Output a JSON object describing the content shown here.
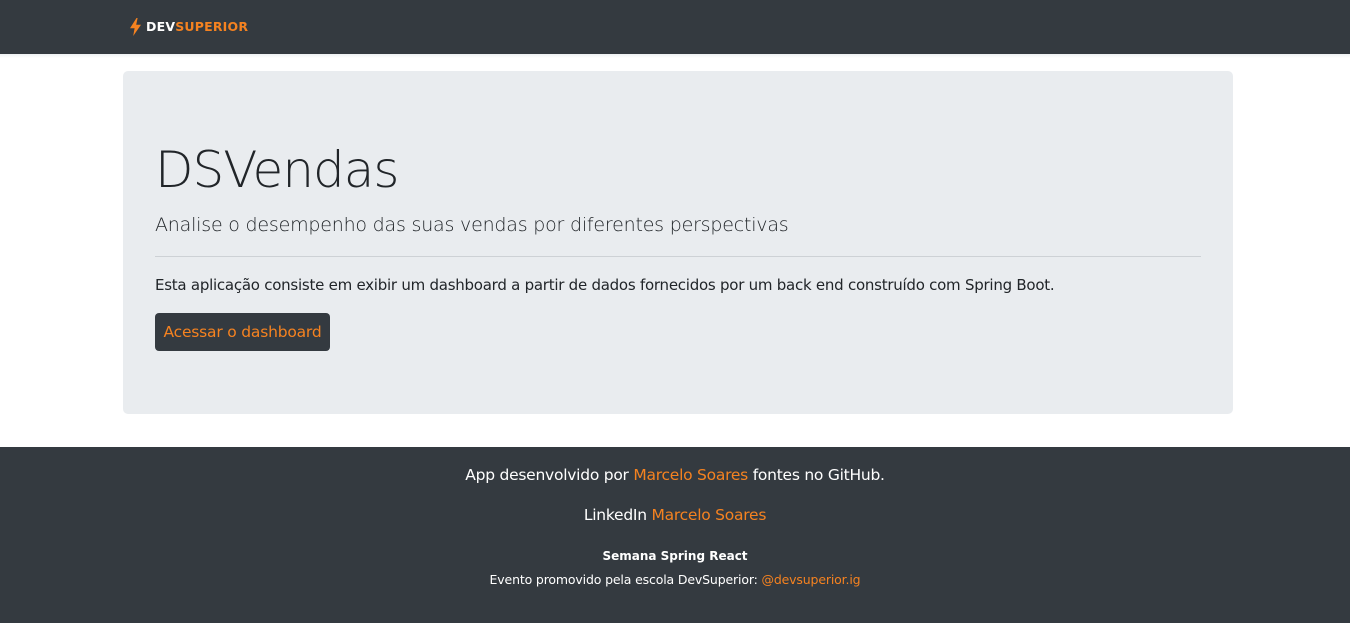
{
  "navbar": {
    "logo_icon": "lightning-bolt-icon",
    "brand_part1": "DEV",
    "brand_part2": "SUPERIOR",
    "colors": {
      "background": "#343a40",
      "accent": "#f58220"
    }
  },
  "hero": {
    "title": "DSVendas",
    "lead": "Analise o desempenho das suas vendas por diferentes perspectivas",
    "description": "Esta aplicação consiste em exibir um dashboard a partir de dados fornecidos por um back end construído com Spring Boot.",
    "button_label": "Acessar o dashboard",
    "background_color": "#e9ecef"
  },
  "footer": {
    "line1_prefix": "App desenvolvido por",
    "line1_link": "Marcelo Soares",
    "line1_suffix": "fontes no GitHub.",
    "line2_prefix": "LinkedIn",
    "line2_link": "Marcelo Soares",
    "event_title": "Semana Spring React",
    "event_text": "Evento promovido pela escola DevSuperior:",
    "event_link": "@devsuperior.ig"
  }
}
